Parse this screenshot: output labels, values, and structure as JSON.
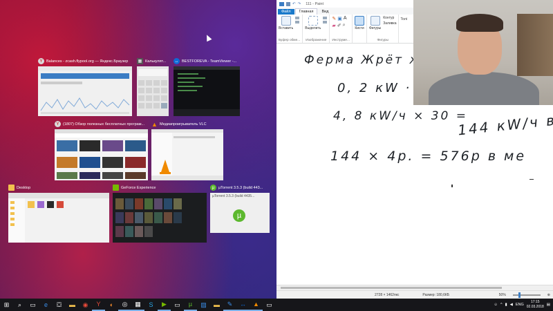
{
  "switcher": {
    "windows": [
      {
        "title": "Balances - zcash.flypool.org — Яндекс.Браузер",
        "icon": "yandex-browser-icon",
        "color": "#f0f0f0"
      },
      {
        "title": "Калькулят...",
        "icon": "calculator-icon",
        "color": "#e6e6e6"
      },
      {
        "title": "BESTFOREVA - TeamViewer -...",
        "icon": "teamviewer-icon",
        "color": "#0f1014"
      },
      {
        "title": "(1807) Обзор полезных бесплатных програм...",
        "icon": "yandex-browser-icon",
        "color": "#f4f4f4"
      },
      {
        "title": "Медиапроигрыватель VLC",
        "icon": "vlc-icon",
        "color": "#f3f3f3"
      },
      {
        "title": "Desktop",
        "icon": "folder-icon",
        "color": "#f2f2f2"
      },
      {
        "title": "GeForce Experience",
        "icon": "geforce-icon",
        "color": "#1b1d1f"
      },
      {
        "title": "µTorrent 3.5.3  (build 443...",
        "icon": "utorrent-icon",
        "color": "#efefef",
        "preview_text": "µTorrent 3.5.3  (build 4435..."
      }
    ]
  },
  "paint": {
    "title": "111 - Paint",
    "tabs": [
      "Файл",
      "Главная",
      "Вид"
    ],
    "groups": [
      {
        "label": "Буфер обме...",
        "tools": [
          "Вставить"
        ]
      },
      {
        "label": "Изображение",
        "tools": [
          "Выделить"
        ]
      },
      {
        "label": "Инструме...",
        "tools": []
      },
      {
        "label": "",
        "tools": [
          "Кисти"
        ]
      },
      {
        "label": "Фигуры",
        "tools": [
          "Фигуры"
        ]
      }
    ],
    "shape_options": [
      "Контур",
      "Заливка"
    ],
    "status": {
      "dimensions": "2728 × 1462пкс",
      "size": "Размер: 180,6КБ",
      "zoom": "50%"
    },
    "canvas_lines": [
      "Ферма  Жрёт ж",
      "0, 2 кW · 2",
      "4, 8 кW/ч × 30 =",
      "144 кW/ч в",
      "144  ×  4р.  =   576р  в ме"
    ]
  },
  "taskbar": {
    "language": "ENG",
    "time": "17:15",
    "date": "02.03.2018"
  }
}
